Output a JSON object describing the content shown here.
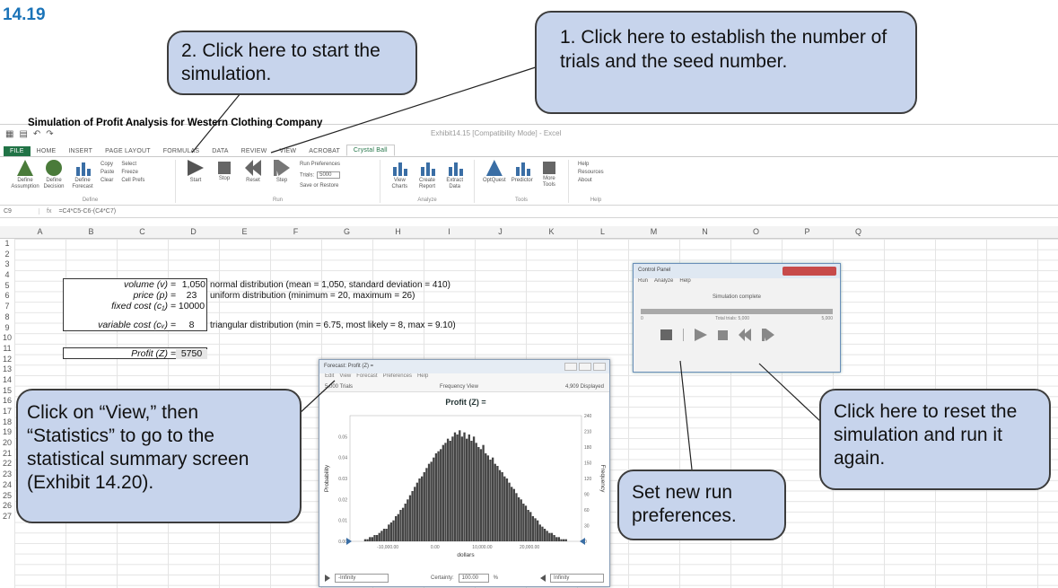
{
  "figure_label": "14.19",
  "window": {
    "title": "Exhibit14.15 [Compatibility Mode] - Excel",
    "quick_access": [
      "▦",
      "▤",
      "↶",
      "↷"
    ]
  },
  "ribbon_tabs": [
    "FILE",
    "HOME",
    "INSERT",
    "PAGE LAYOUT",
    "FORMULAS",
    "DATA",
    "REVIEW",
    "VIEW",
    "ACROBAT",
    "Crystal Ball"
  ],
  "ribbon": {
    "define": {
      "group_label": "Define",
      "buttons": [
        "Define Assumption",
        "Define Decision",
        "Define Forecast"
      ],
      "small": [
        "Copy",
        "Paste",
        "Clear",
        "Select",
        "Freeze",
        "Cell Prefs"
      ]
    },
    "run": {
      "group_label": "Run",
      "buttons": [
        "Start",
        "Stop",
        "Reset",
        "Step"
      ],
      "prefs_label": "Run Preferences",
      "trials_label": "Trials:",
      "trials_value": "5000",
      "save_label": "Save or Restore"
    },
    "analyze": {
      "group_label": "Analyze",
      "buttons": [
        "View Charts",
        "Create Report",
        "Extract Data"
      ]
    },
    "tools": {
      "group_label": "Tools",
      "buttons": [
        "OptQuest",
        "Predictor",
        "More Tools"
      ]
    },
    "help": {
      "group_label": "Help",
      "items": [
        "Help",
        "Resources",
        "About"
      ]
    }
  },
  "formula_bar": {
    "name_box": "C9",
    "fx": "fx",
    "formula": "=C4*C5-C6-(C4*C7)"
  },
  "columns": [
    "A",
    "B",
    "C",
    "D",
    "E",
    "F",
    "G",
    "H",
    "I",
    "J",
    "K",
    "L",
    "M",
    "N",
    "O",
    "P",
    "Q"
  ],
  "rows": [
    "1",
    "2",
    "3",
    "4",
    "5",
    "6",
    "7",
    "8",
    "9",
    "10",
    "11",
    "12",
    "13",
    "14",
    "15",
    "16",
    "17",
    "18",
    "19",
    "20",
    "21",
    "22",
    "23",
    "24",
    "25",
    "26",
    "27"
  ],
  "sheet": {
    "title": "Simulation of Profit Analysis for Western Clothing Company",
    "volume_label": "volume (v) =",
    "volume_value": "1,050",
    "volume_note": "normal distribution (mean = 1,050, standard deviation = 410)",
    "price_label": "price (p) =",
    "price_value": "23",
    "price_note": "uniform distribution (minimum = 20, maximum = 26)",
    "fixed_label": "fixed cost (c₁) =",
    "fixed_value": "10000",
    "variable_label": "variable cost (cᵥ) =",
    "variable_value": "8",
    "variable_note": "triangular distribution (min = 6.75, most likely = 8, max = 9.10)",
    "profit_label": "Profit (Z) =",
    "profit_value": "5750"
  },
  "control_panel": {
    "title": "Control Panel",
    "menu": [
      "Run",
      "Analyze",
      "Help"
    ],
    "status": "Simulation complete",
    "total_trials": "Total trials: 5,000",
    "scale_min": "0",
    "scale_max": "5,000",
    "progress_fraction": 1.0
  },
  "forecast": {
    "title": "Forecast: Profit (Z) =",
    "menu": [
      "Edit",
      "View",
      "Forecast",
      "Preferences",
      "Help"
    ],
    "trials": "5,000 Trials",
    "view": "Frequency View",
    "displayed": "4,909 Displayed",
    "chart_title": "Profit (Z) =",
    "left_input": "-Infinity",
    "certainty_label": "Certainty:",
    "certainty_value": "100.00",
    "percent": "%",
    "right_input": "Infinity"
  },
  "chart_data": {
    "type": "bar",
    "title": "Profit (Z) =",
    "xlabel": "dollars",
    "ylabel": "Probability",
    "y2label": "Frequency",
    "xlim": [
      -18000,
      31000
    ],
    "ylim": [
      0,
      0.06
    ],
    "x_ticks": [
      -10000,
      0,
      10000,
      20000
    ],
    "x_tick_labels": [
      "-10,000.00",
      "0.00",
      "10,000.00",
      "20,000.00"
    ],
    "y_ticks": [
      "0.00",
      "0.01",
      "0.02",
      "0.03",
      "0.04",
      "0.05"
    ],
    "y2_ticks": [
      "0",
      "30",
      "60",
      "90",
      "120",
      "150",
      "180",
      "210",
      "240"
    ],
    "bin_start": -15000,
    "bin_width": 500,
    "values": [
      0.001,
      0.001,
      0.002,
      0.002,
      0.003,
      0.003,
      0.004,
      0.005,
      0.006,
      0.006,
      0.008,
      0.009,
      0.01,
      0.012,
      0.013,
      0.015,
      0.016,
      0.018,
      0.02,
      0.022,
      0.024,
      0.026,
      0.028,
      0.03,
      0.031,
      0.033,
      0.035,
      0.037,
      0.038,
      0.04,
      0.042,
      0.043,
      0.044,
      0.046,
      0.047,
      0.049,
      0.048,
      0.05,
      0.052,
      0.051,
      0.053,
      0.05,
      0.052,
      0.049,
      0.051,
      0.048,
      0.05,
      0.047,
      0.045,
      0.044,
      0.046,
      0.042,
      0.041,
      0.039,
      0.04,
      0.037,
      0.036,
      0.034,
      0.033,
      0.031,
      0.03,
      0.028,
      0.026,
      0.025,
      0.023,
      0.021,
      0.02,
      0.018,
      0.017,
      0.015,
      0.014,
      0.012,
      0.011,
      0.01,
      0.008,
      0.007,
      0.006,
      0.005,
      0.004,
      0.004,
      0.003,
      0.002,
      0.002,
      0.001,
      0.001,
      0.001
    ]
  },
  "callouts": {
    "start": "2. Click here to start the simulation.",
    "trials": "1. Click here to establish the number of trials and the seed number.",
    "view": "Click on “View,” then “Statistics” to go to the statistical summary screen (Exhibit 14.20).",
    "reset": "Click here to reset the simulation and run it again.",
    "prefs": "Set new run preferences."
  }
}
